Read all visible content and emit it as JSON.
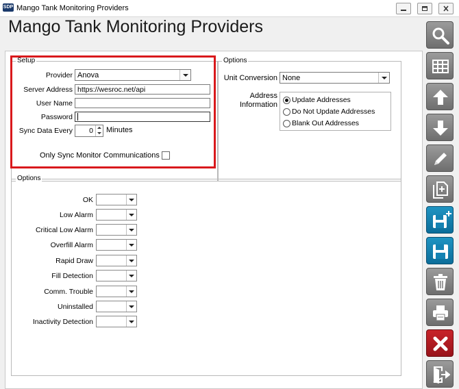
{
  "window": {
    "title": "Mango Tank Monitoring Providers",
    "app_icon_text": "SDP"
  },
  "page_title": "Mango Tank Monitoring Providers",
  "setup": {
    "legend": "Setup",
    "provider_label": "Provider",
    "provider_value": "Anova",
    "server_address_label": "Server Address",
    "server_address_value": "https://wesroc.net/api",
    "user_name_label": "User Name",
    "user_name_value": "",
    "password_label": "Password",
    "password_value": "",
    "sync_label": "Sync Data Every",
    "sync_value": "0",
    "sync_unit": "Minutes",
    "only_sync_label": "Only Sync Monitor Communications",
    "only_sync_checked": false
  },
  "options_top": {
    "legend": "Options",
    "unit_conversion_label": "Unit Conversion",
    "unit_conversion_value": "None",
    "address_info_label_line1": "Address",
    "address_info_label_line2": "Information",
    "address_radio": [
      {
        "label": "Update Addresses",
        "selected": true
      },
      {
        "label": "Do Not Update Addresses",
        "selected": false
      },
      {
        "label": "Blank Out Addresses",
        "selected": false
      }
    ]
  },
  "options_bottom": {
    "legend": "Options",
    "rows": [
      {
        "label": "OK",
        "value": ""
      },
      {
        "label": "Low Alarm",
        "value": ""
      },
      {
        "label": "Critical Low Alarm",
        "value": ""
      },
      {
        "label": "Overfill Alarm",
        "value": ""
      },
      {
        "label": "Rapid Draw",
        "value": ""
      },
      {
        "label": "Fill Detection",
        "value": ""
      },
      {
        "label": "Comm. Trouble",
        "value": ""
      },
      {
        "label": "Uninstalled",
        "value": ""
      },
      {
        "label": "Inactivity Detection",
        "value": ""
      }
    ]
  },
  "toolbar": {
    "buttons": [
      {
        "name": "search-button",
        "icon": "magnifier-icon",
        "style": "gray"
      },
      {
        "name": "grid-button",
        "icon": "grid-icon",
        "style": "gray"
      },
      {
        "name": "move-up-button",
        "icon": "arrow-up-icon",
        "style": "gray"
      },
      {
        "name": "move-down-button",
        "icon": "arrow-down-icon",
        "style": "gray"
      },
      {
        "name": "edit-button",
        "icon": "pencil-icon",
        "style": "gray"
      },
      {
        "name": "copy-button",
        "icon": "copy-document-icon",
        "style": "gray"
      },
      {
        "name": "save-new-button",
        "icon": "save-plus-icon",
        "style": "blue"
      },
      {
        "name": "save-button",
        "icon": "save-icon",
        "style": "blue"
      },
      {
        "name": "delete-button",
        "icon": "trash-icon",
        "style": "gray"
      },
      {
        "name": "print-button",
        "icon": "printer-icon",
        "style": "gray"
      },
      {
        "name": "cancel-button",
        "icon": "x-icon",
        "style": "red"
      },
      {
        "name": "exit-button",
        "icon": "exit-door-icon",
        "style": "gray"
      }
    ]
  },
  "colors": {
    "highlight_red": "#d9191c",
    "toolbar_gray": "#7c7c7c",
    "toolbar_blue": "#1583b3",
    "toolbar_red": "#b21c22"
  }
}
